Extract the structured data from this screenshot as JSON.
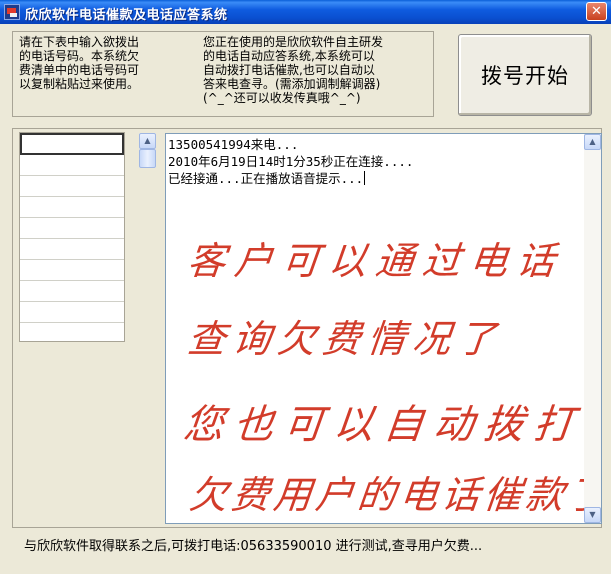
{
  "window": {
    "title": "欣欣软件电话催款及电话应答系统",
    "close_glyph": "✕"
  },
  "top_panel": {
    "hint_left": "请在下表中输入欲拨出\n的电话号码。本系统欠\n费清单中的电话号码可\n以复制粘贴过来使用。",
    "hint_right": "您正在使用的是欣欣软件自主研发\n的电话自动应答系统,本系统可以\n自动拨打电话催款,也可以自动以\n答来电查寻。(需添加调制解调器)\n   (^_^还可以收发传真哦^_^)"
  },
  "dial_button": {
    "label": "拨号开始"
  },
  "log": {
    "lines": [
      "13500541994来电...",
      "2010年6月19日14时1分35秒正在连接....",
      "已经接通...正在播放语音提示..."
    ]
  },
  "annotation": {
    "lines": [
      "客户可以通过电话",
      "查询欠费情况了",
      "您也可以自动拨打",
      "欠费用户的电话催款了"
    ],
    "color": "#d23c2a"
  },
  "scrollbar": {
    "up_glyph": "▲",
    "down_glyph": "▼"
  },
  "status_bar": {
    "text": "与欣欣软件取得联系之后,可拨打电话:05633590010 进行测试,查寻用户欠费..."
  }
}
